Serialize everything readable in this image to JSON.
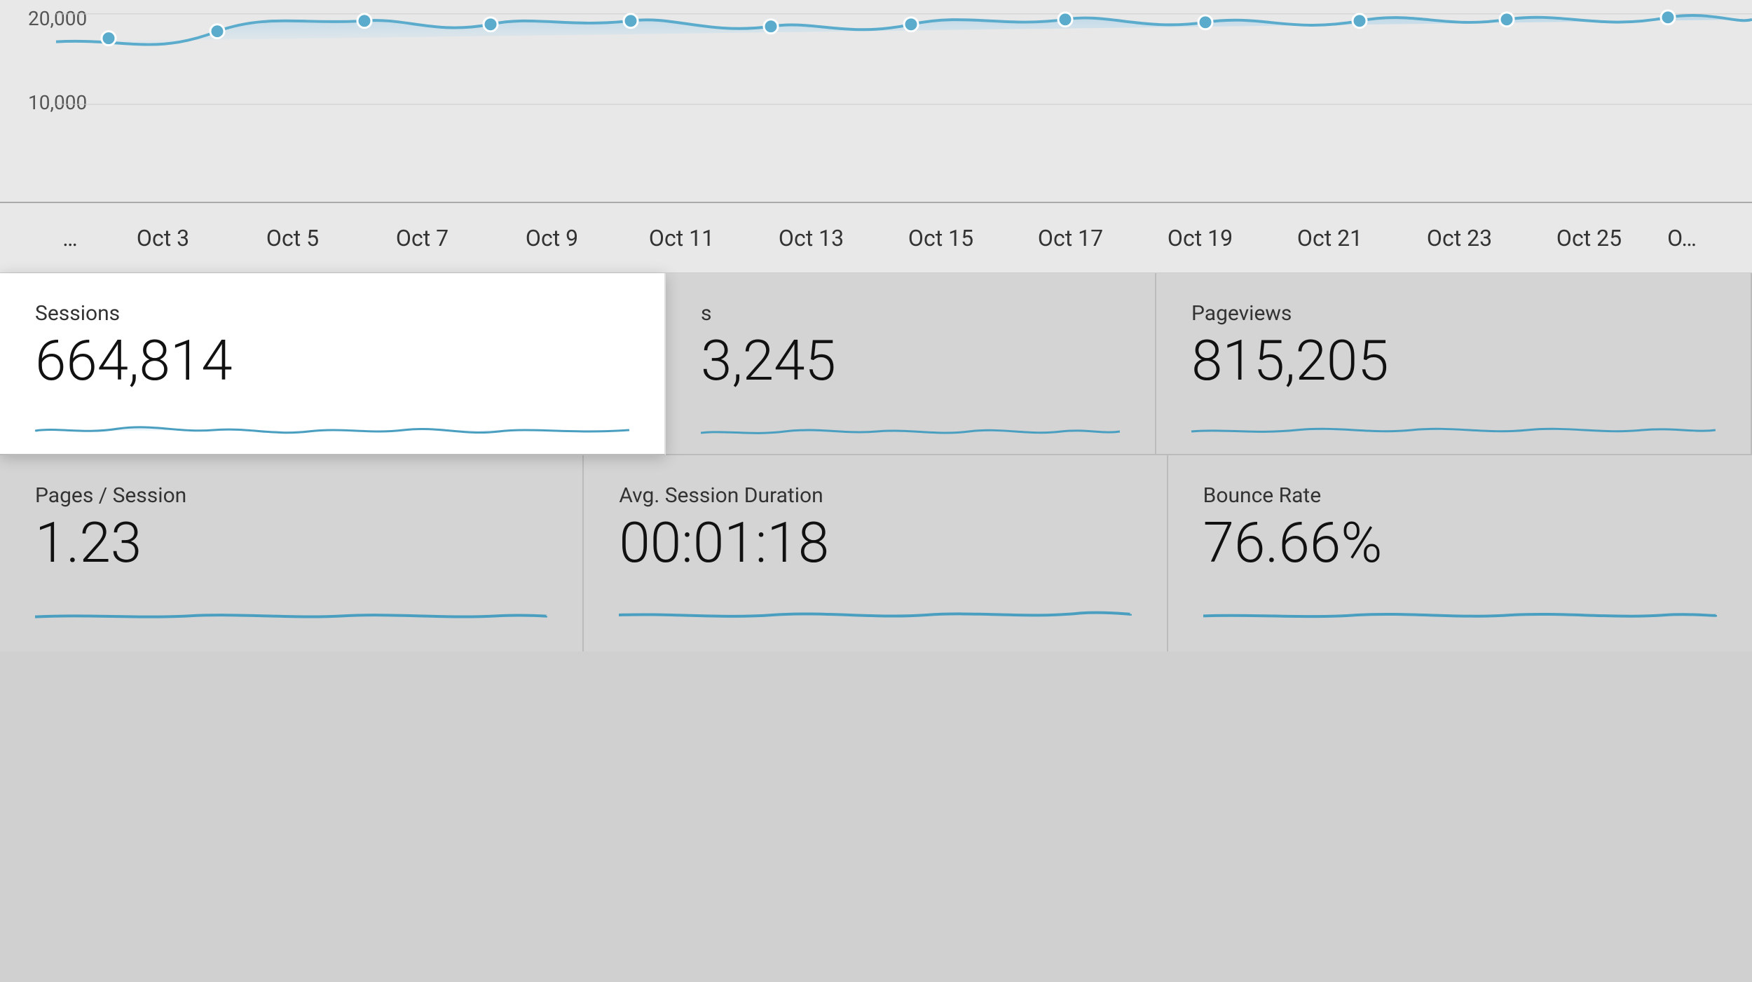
{
  "chart": {
    "y_labels": [
      "20,000",
      "10,000"
    ],
    "x_labels": [
      "…",
      "Oct 3",
      "Oct 5",
      "Oct 7",
      "Oct 9",
      "Oct 11",
      "Oct 13",
      "Oct 15",
      "Oct 17",
      "Oct 19",
      "Oct 21",
      "Oct 23",
      "Oct 25",
      "O…"
    ]
  },
  "metrics_top": [
    {
      "label": "Sessions",
      "value": "664,814",
      "highlighted": true
    },
    {
      "label": "s",
      "value": "3,245",
      "highlighted": false,
      "partial": true
    },
    {
      "label": "Pageviews",
      "value": "815,205",
      "highlighted": false
    }
  ],
  "metrics_bottom": [
    {
      "label": "Pages / Session",
      "value": "1.23"
    },
    {
      "label": "Avg. Session Duration",
      "value": "00:01:18"
    },
    {
      "label": "Bounce Rate",
      "value": "76.66%"
    }
  ]
}
